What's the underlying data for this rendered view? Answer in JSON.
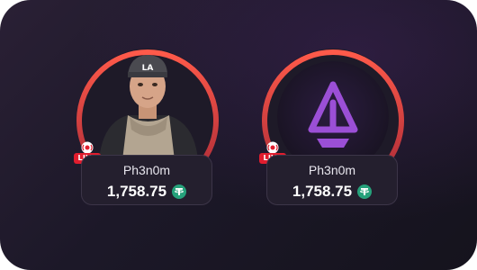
{
  "cards": [
    {
      "name": "Ph3n0m",
      "amount": "1,758.75",
      "live_label": "LIVE",
      "avatar": "person-photo",
      "currency_icon": "tether-icon"
    },
    {
      "name": "Ph3n0m",
      "amount": "1,758.75",
      "live_label": "LIVE",
      "avatar": "purple-logo",
      "currency_icon": "tether-icon"
    }
  ],
  "colors": {
    "ring_red": "#e4483b",
    "live_red": "#e11d2e",
    "logo_purple": "#9b4fd6",
    "tether_green": "#26a17b"
  }
}
